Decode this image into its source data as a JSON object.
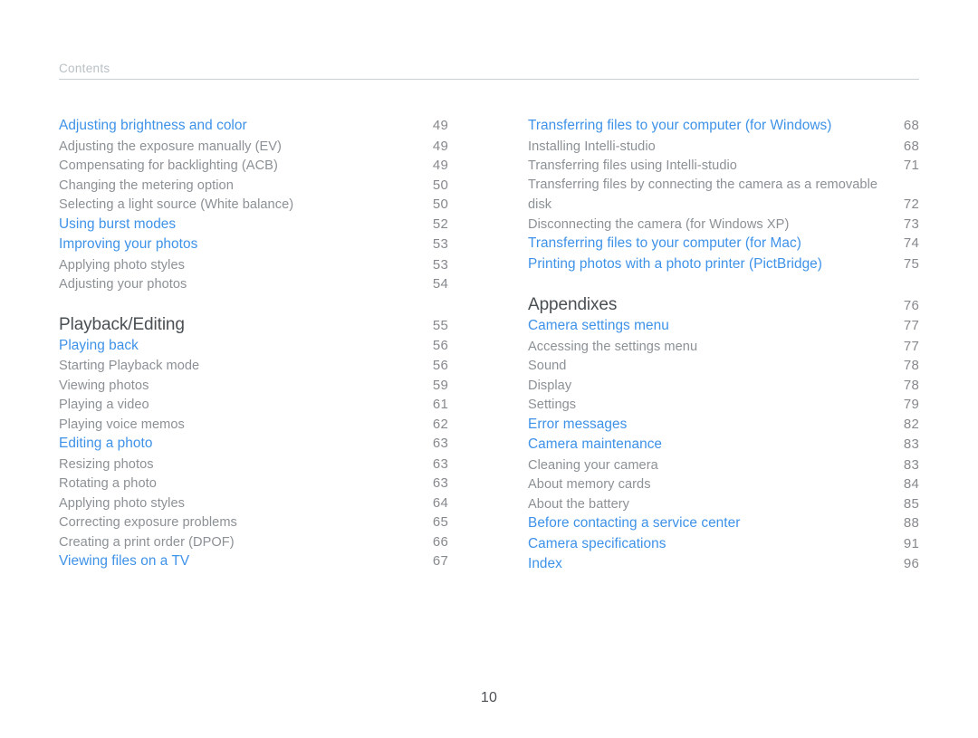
{
  "running_head": {
    "text": "Contents"
  },
  "folio": {
    "page_number": "10"
  },
  "colors": {
    "link_blue": "#3e92e8",
    "section_dark": "#4a4f54",
    "body_gray": "#8c9196",
    "leader_gray": "#b5bbc0",
    "rule_gray": "#c9d0d4",
    "running_head_gray": "#b9c0c4"
  },
  "left_column": [
    {
      "label": "Adjusting brightness and color",
      "page": "49",
      "level": "head",
      "gap_before": false
    },
    {
      "label": "Adjusting the exposure manually (EV)",
      "page": "49",
      "level": "sub",
      "gap_before": false
    },
    {
      "label": "Compensating for backlighting (ACB)",
      "page": "49",
      "level": "sub",
      "gap_before": false
    },
    {
      "label": "Changing the metering option",
      "page": "50",
      "level": "sub",
      "gap_before": false
    },
    {
      "label": "Selecting a light source (White balance)",
      "page": "50",
      "level": "sub",
      "gap_before": false
    },
    {
      "label": "Using burst modes",
      "page": "52",
      "level": "head",
      "gap_before": false
    },
    {
      "label": "Improving your photos",
      "page": "53",
      "level": "head",
      "gap_before": false
    },
    {
      "label": "Applying photo styles",
      "page": "53",
      "level": "sub",
      "gap_before": false
    },
    {
      "label": "Adjusting your photos",
      "page": "54",
      "level": "sub",
      "gap_before": false
    },
    {
      "label": "Playback/Editing",
      "page": "55",
      "level": "section",
      "gap_before": true
    },
    {
      "label": "Playing back",
      "page": "56",
      "level": "head",
      "gap_before": false
    },
    {
      "label": "Starting Playback mode",
      "page": "56",
      "level": "sub",
      "gap_before": false
    },
    {
      "label": "Viewing photos",
      "page": "59",
      "level": "sub",
      "gap_before": false
    },
    {
      "label": "Playing a video",
      "page": "61",
      "level": "sub",
      "gap_before": false
    },
    {
      "label": "Playing voice memos",
      "page": "62",
      "level": "sub",
      "gap_before": false
    },
    {
      "label": "Editing a photo",
      "page": "63",
      "level": "head",
      "gap_before": false
    },
    {
      "label": "Resizing photos",
      "page": "63",
      "level": "sub",
      "gap_before": false
    },
    {
      "label": "Rotating a photo",
      "page": "63",
      "level": "sub",
      "gap_before": false
    },
    {
      "label": "Applying photo styles",
      "page": "64",
      "level": "sub",
      "gap_before": false
    },
    {
      "label": "Correcting exposure problems",
      "page": "65",
      "level": "sub",
      "gap_before": false
    },
    {
      "label": "Creating a print order (DPOF)",
      "page": "66",
      "level": "sub",
      "gap_before": false
    },
    {
      "label": "Viewing files on a TV",
      "page": "67",
      "level": "head",
      "gap_before": false
    }
  ],
  "right_column": [
    {
      "label": "Transferring files to your computer (for Windows)",
      "page": "68",
      "level": "head",
      "gap_before": false
    },
    {
      "label": "Installing Intelli-studio",
      "page": "68",
      "level": "sub",
      "gap_before": false
    },
    {
      "label": "Transferring files using Intelli-studio",
      "page": "71",
      "level": "sub",
      "gap_before": false
    },
    {
      "label": "Transferring files by connecting the camera as a removable",
      "page": "",
      "level": "sub",
      "wrap_first": true,
      "gap_before": false
    },
    {
      "label": "disk",
      "page": "72",
      "level": "sub",
      "gap_before": false
    },
    {
      "label": "Disconnecting the camera (for Windows XP)",
      "page": "73",
      "level": "sub",
      "gap_before": false
    },
    {
      "label": "Transferring files to your computer (for Mac)",
      "page": "74",
      "level": "head",
      "gap_before": false
    },
    {
      "label": "Printing photos with a photo printer (PictBridge)",
      "page": "75",
      "level": "head",
      "gap_before": false
    },
    {
      "label": "Appendixes",
      "page": "76",
      "level": "section",
      "gap_before": true
    },
    {
      "label": "Camera settings menu",
      "page": "77",
      "level": "head",
      "gap_before": false
    },
    {
      "label": "Accessing the settings menu",
      "page": "77",
      "level": "sub",
      "gap_before": false
    },
    {
      "label": "Sound",
      "page": "78",
      "level": "sub",
      "gap_before": false
    },
    {
      "label": "Display",
      "page": "78",
      "level": "sub",
      "gap_before": false
    },
    {
      "label": "Settings",
      "page": "79",
      "level": "sub",
      "gap_before": false
    },
    {
      "label": "Error messages",
      "page": "82",
      "level": "head",
      "gap_before": false
    },
    {
      "label": "Camera maintenance",
      "page": "83",
      "level": "head",
      "gap_before": false
    },
    {
      "label": "Cleaning your camera",
      "page": "83",
      "level": "sub",
      "gap_before": false
    },
    {
      "label": "About memory cards",
      "page": "84",
      "level": "sub",
      "gap_before": false
    },
    {
      "label": "About the battery",
      "page": "85",
      "level": "sub",
      "gap_before": false
    },
    {
      "label": "Before contacting a service center",
      "page": "88",
      "level": "head",
      "gap_before": false
    },
    {
      "label": "Camera specifications",
      "page": "91",
      "level": "head",
      "gap_before": false
    },
    {
      "label": "Index",
      "page": "96",
      "level": "head",
      "gap_before": false
    }
  ]
}
